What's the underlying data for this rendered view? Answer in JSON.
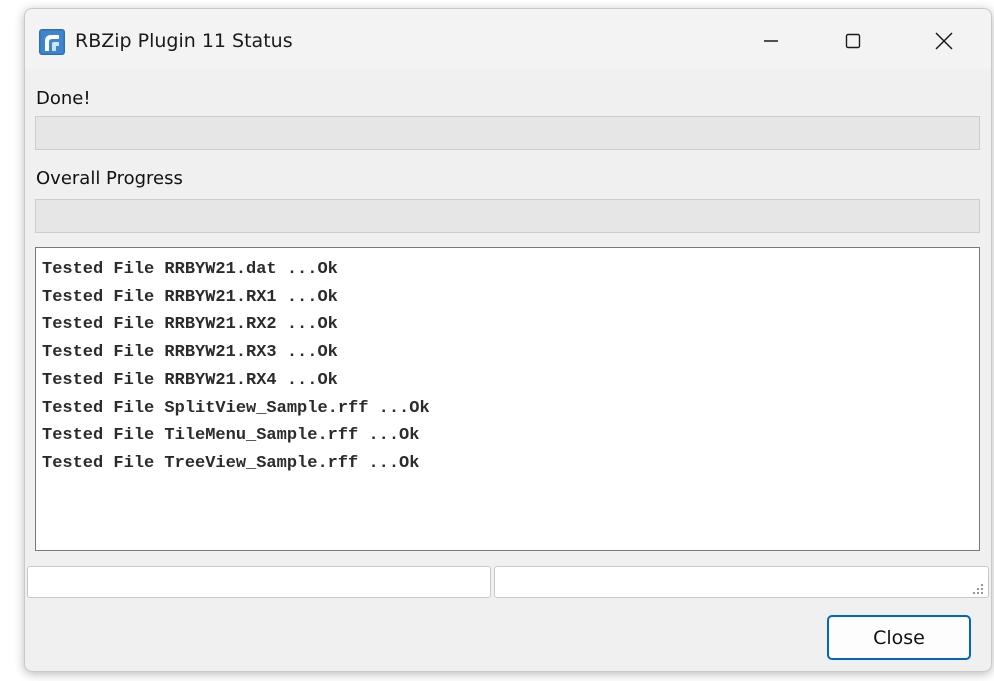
{
  "window": {
    "title": "RBZip Plugin 11 Status",
    "icon": "rbzip-app-icon",
    "controls": {
      "minimize_icon": "minimize-icon",
      "maximize_icon": "maximize-icon",
      "close_icon": "close-icon"
    }
  },
  "status": {
    "label": "Done!",
    "progress_fraction": 0
  },
  "overall": {
    "label": "Overall Progress",
    "progress_fraction": 0
  },
  "log": {
    "lines": [
      "Tested File RRBYW21.dat ...Ok",
      "Tested File RRBYW21.RX1 ...Ok",
      "Tested File RRBYW21.RX2 ...Ok",
      "Tested File RRBYW21.RX3 ...Ok",
      "Tested File RRBYW21.RX4 ...Ok",
      "Tested File SplitView_Sample.rff ...Ok",
      "Tested File TileMenu_Sample.rff ...Ok",
      "Tested File TreeView_Sample.rff ...Ok"
    ]
  },
  "statusbar": {
    "left_text": "",
    "right_text": ""
  },
  "buttons": {
    "close_label": "Close"
  },
  "colors": {
    "accent": "#0067c0",
    "progress_fill": "#06b025"
  }
}
